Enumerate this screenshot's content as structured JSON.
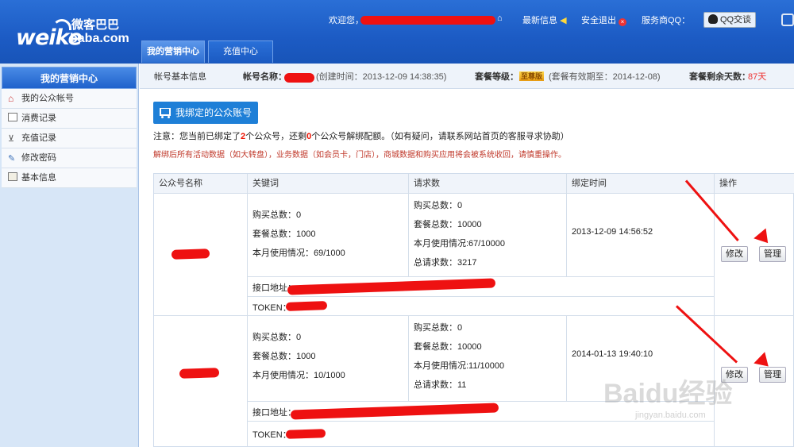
{
  "header": {
    "logo_main": "weike",
    "logo_cn": "微客巴巴",
    "logo_sub": "baba.com",
    "welcome": "欢迎您，",
    "latest_info": "最新信息",
    "logout": "安全退出",
    "service_qq": "服务商QQ：",
    "qq_chat": "QQ交谈"
  },
  "tabs": [
    {
      "label": "我的营销中心"
    },
    {
      "label": "充值中心"
    }
  ],
  "sidebar": {
    "title": "我的营销中心",
    "items": [
      {
        "label": "我的公众帐号",
        "icon": "home-icon"
      },
      {
        "label": "消费记录",
        "icon": "list-icon"
      },
      {
        "label": "充值记录",
        "icon": "cart-icon"
      },
      {
        "label": "修改密码",
        "icon": "pencil-icon"
      },
      {
        "label": "基本信息",
        "icon": "folder-icon"
      }
    ]
  },
  "infobar": {
    "section_title": "帐号基本信息",
    "account_label": "帐号名称：",
    "created": "(创建时间：2013-12-09 14:38:35)",
    "level_label": "套餐等级：",
    "level_badge": "至尊版",
    "valid_until": "(套餐有效期至：2014-12-08)",
    "remaining_label": "套餐剩余天数：",
    "remaining_days": "87天"
  },
  "main": {
    "bind_button": "我绑定的公众账号",
    "note_prefix": "注意：您当前已绑定了",
    "note_bound": "2",
    "note_middle": "个公众号，还剩",
    "note_left": "0",
    "note_suffix": "个公众号解绑配额。（如有疑问，请联系网站首页的客服寻求协助）",
    "warning": "解绑后所有活动数据（如大转盘），业务数据（如会员卡，门店），商城数据和购买应用将会被系统收回，请慎重操作。"
  },
  "table": {
    "headers": [
      "公众号名称",
      "关键词",
      "请求数",
      "绑定时间",
      "操作"
    ],
    "rows": [
      {
        "kw_total": "购买总数：0",
        "kw_package": "套餐总数：1000",
        "kw_usage": "本月使用情况：69/1000",
        "req_total": "购买总数：0",
        "req_package": "套餐总数：10000",
        "req_usage": "本月使用情况:67/10000",
        "req_all": "总请求数：3217",
        "bind_time": "2013-12-09 14:56:52",
        "api_label": "接口地址：",
        "token_label": "TOKEN：",
        "edit": "修改",
        "manage": "管理"
      },
      {
        "kw_total": "购买总数：0",
        "kw_package": "套餐总数：1000",
        "kw_usage": "本月使用情况：10/1000",
        "req_total": "购买总数：0",
        "req_package": "套餐总数：10000",
        "req_usage": "本月使用情况:11/10000",
        "req_all": "总请求数：11",
        "bind_time": "2014-01-13 19:40:10",
        "api_label": "接口地址：",
        "token_label": "TOKEN：",
        "edit": "修改",
        "manage": "管理"
      }
    ]
  },
  "watermark": {
    "text": "Baidu经验",
    "sub": "jingyan.baidu.com"
  },
  "colors": {
    "header_blue": "#1c5bc4",
    "accent_red": "#e11",
    "button_blue": "#1e7fd7",
    "days_red": "#e33"
  }
}
